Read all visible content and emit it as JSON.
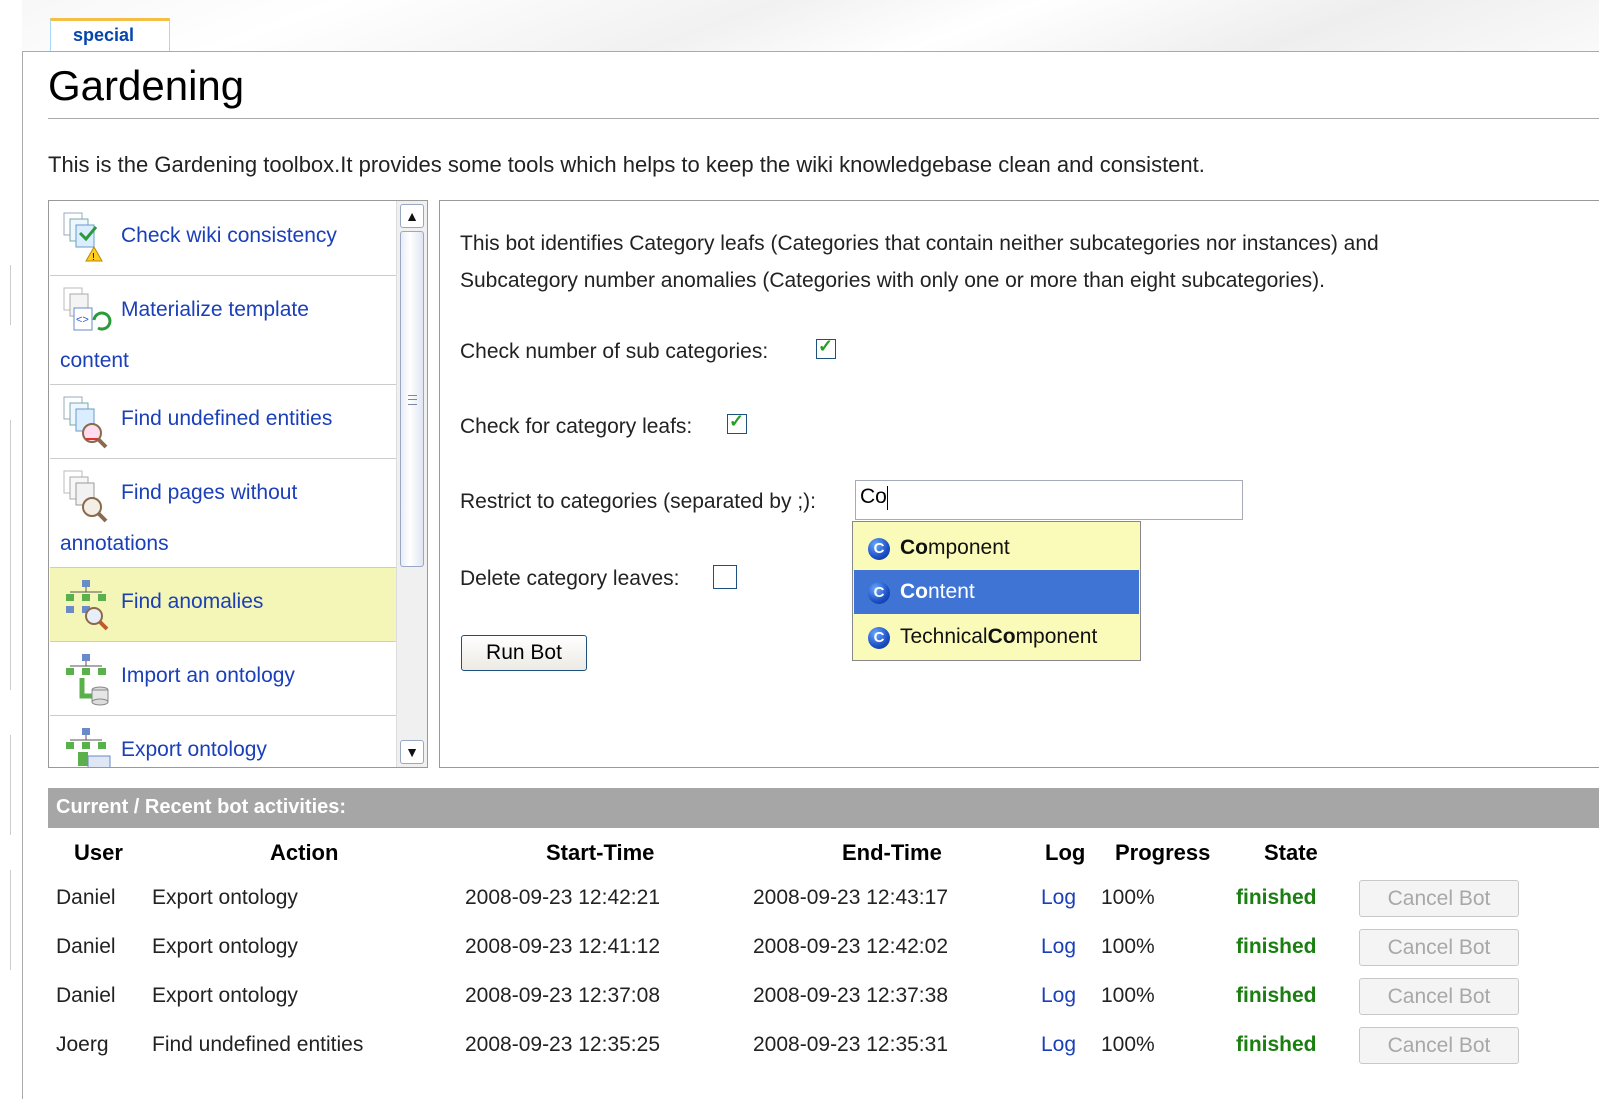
{
  "tab": {
    "label": "special"
  },
  "page": {
    "title": "Gardening",
    "intro": "This is the Gardening toolbox.It provides some tools which helps to keep the wiki knowledgebase clean and consistent."
  },
  "tools": [
    {
      "line1": "Check wiki consistency",
      "line2": "",
      "icon": "check-consistency-icon"
    },
    {
      "line1": "Materialize template",
      "line2": "content",
      "icon": "materialize-template-icon"
    },
    {
      "line1": "Find undefined entities",
      "line2": "",
      "icon": "find-undefined-icon"
    },
    {
      "line1": "Find pages without",
      "line2": "annotations",
      "icon": "find-pages-icon"
    },
    {
      "line1": "Find anomalies",
      "line2": "",
      "icon": "find-anomalies-icon",
      "selected": true
    },
    {
      "line1": "Import an ontology",
      "line2": "",
      "icon": "import-ontology-icon"
    },
    {
      "line1": "Export ontology",
      "line2": "",
      "icon": "export-ontology-icon"
    }
  ],
  "bot": {
    "desc_line1": "This bot identifies Category leafs (Categories that contain neither subcategories nor instances) and",
    "desc_line2": "Subcategory number anomalies (Categories with only one or more than eight subcategories).",
    "check_sub_label": "Check number of sub categories:",
    "check_sub_checked": true,
    "check_leafs_label": "Check for category leafs:",
    "check_leafs_checked": true,
    "restrict_label": "Restrict to categories (separated by ;):",
    "restrict_value": "Co",
    "delete_label": "Delete category leaves:",
    "delete_checked": false,
    "run_label": "Run Bot"
  },
  "autocomplete": [
    {
      "prefix": "",
      "match": "Co",
      "rest": "mponent",
      "highlighted": false
    },
    {
      "prefix": "",
      "match": "Co",
      "rest": "ntent",
      "highlighted": true
    },
    {
      "prefix": "Technical",
      "match": "Co",
      "rest": "mponent",
      "highlighted": false
    }
  ],
  "activities": {
    "heading": "Current / Recent bot activities:",
    "headers": {
      "user": "User",
      "action": "Action",
      "start": "Start-Time",
      "end": "End-Time",
      "log": "Log",
      "progress": "Progress",
      "state": "State"
    },
    "rows": [
      {
        "user": "Daniel",
        "action": "Export ontology",
        "start": "2008-09-23 12:42:21",
        "end": "2008-09-23 12:43:17",
        "log": "Log",
        "progress": "100%",
        "state": "finished",
        "cancel": "Cancel Bot"
      },
      {
        "user": "Daniel",
        "action": "Export ontology",
        "start": "2008-09-23 12:41:12",
        "end": "2008-09-23 12:42:02",
        "log": "Log",
        "progress": "100%",
        "state": "finished",
        "cancel": "Cancel Bot"
      },
      {
        "user": "Daniel",
        "action": "Export ontology",
        "start": "2008-09-23 12:37:08",
        "end": "2008-09-23 12:37:38",
        "log": "Log",
        "progress": "100%",
        "state": "finished",
        "cancel": "Cancel Bot"
      },
      {
        "user": "Joerg",
        "action": "Find undefined entities",
        "start": "2008-09-23 12:35:25",
        "end": "2008-09-23 12:35:31",
        "log": "Log",
        "progress": "100%",
        "state": "finished",
        "cancel": "Cancel Bot"
      }
    ]
  },
  "colors": {
    "link": "#1a3fb8",
    "selected_tool": "#f3f6b6",
    "state_finished": "#1a7e11",
    "highlight": "#3f74d4",
    "autocomplete_bg": "#fafab9"
  }
}
